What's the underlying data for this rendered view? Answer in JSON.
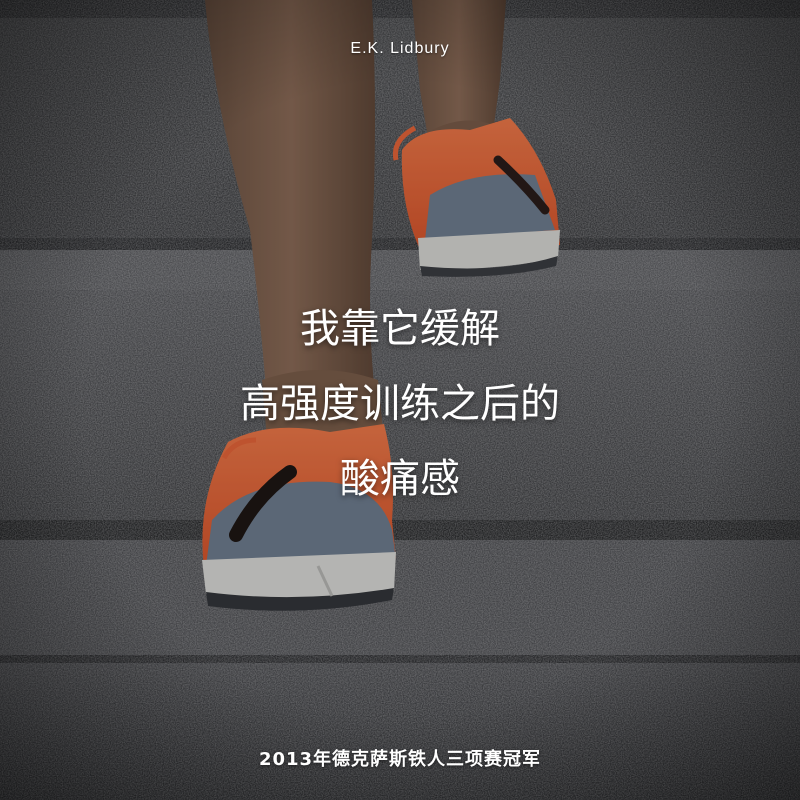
{
  "attribution": "E.K. Lidbury",
  "quote": {
    "lines": [
      "我靠它缓解",
      "高强度训练之后的",
      "酸痛感"
    ]
  },
  "caption": "2013年德克萨斯铁人三项赛冠军",
  "photo": {
    "subject": "runner-climbing-stone-steps",
    "colors": {
      "stone_dark": "#2a2b2d",
      "stone_light": "#5c5d60",
      "shoe_orange": "#e5663a",
      "shoe_grey": "#6f7e90",
      "sole_white": "#d9d9d6",
      "skin": "#8a6a55"
    }
  }
}
